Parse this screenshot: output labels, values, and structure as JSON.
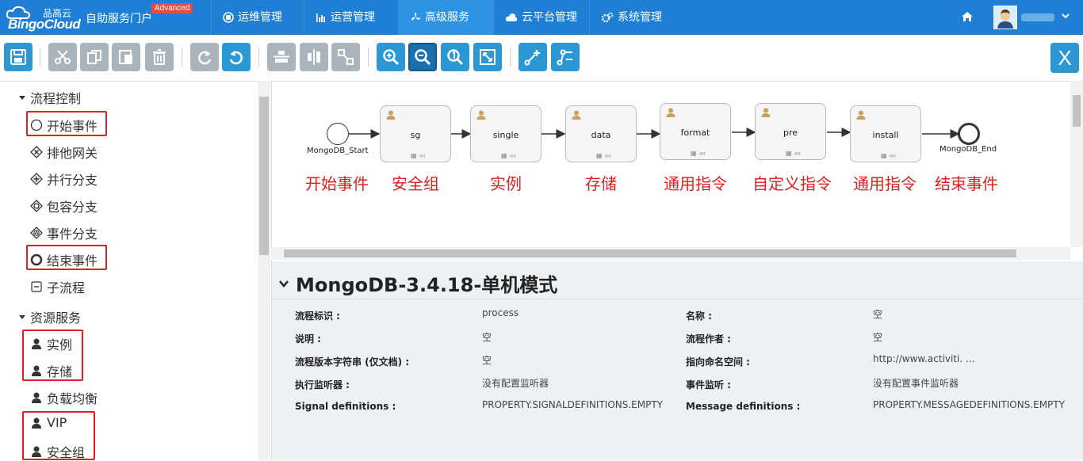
{
  "header": {
    "logo_cn": "品高云",
    "logo_en": "BingoCloud",
    "portal_label": "自助服务门户",
    "badge": "Advanced",
    "nav": [
      {
        "label": "运维管理",
        "icon": "ops-icon"
      },
      {
        "label": "运营管理",
        "icon": "bar-chart-icon"
      },
      {
        "label": "高级服务",
        "icon": "fan-icon"
      },
      {
        "label": "云平台管理",
        "icon": "cloud-icon"
      },
      {
        "label": "系统管理",
        "icon": "gears-icon"
      }
    ],
    "active_nav": "高级服务",
    "colors": {
      "bar": "#1f7fd4",
      "active": "#2f93e4",
      "badge": "#e74c3c"
    }
  },
  "toolbar": {
    "buttons": [
      "save-icon",
      "cut-icon",
      "copy-icon",
      "paste-icon",
      "delete-icon",
      "redo-icon",
      "undo-icon",
      "align-icon",
      "align-center-icon",
      "resize-icon",
      "zoom-in-icon",
      "zoom-out-icon",
      "zoom-actual-icon",
      "zoom-fit-icon",
      "flow-add-icon",
      "flow-branch-icon"
    ],
    "close_label": "X"
  },
  "sidebar": {
    "groups": [
      {
        "label": "流程控制",
        "items": [
          {
            "label": "开始事件",
            "icon": "circle-thin-icon"
          },
          {
            "label": "排他网关",
            "icon": "gateway-x-icon"
          },
          {
            "label": "并行分支",
            "icon": "gateway-plus-icon"
          },
          {
            "label": "包容分支",
            "icon": "gateway-o-icon"
          },
          {
            "label": "事件分支",
            "icon": "gateway-event-icon"
          },
          {
            "label": "结束事件",
            "icon": "circle-thick-icon"
          },
          {
            "label": "子流程",
            "icon": "subprocess-icon"
          }
        ]
      },
      {
        "label": "资源服务",
        "items": [
          {
            "label": "实例",
            "icon": "user-icon"
          },
          {
            "label": "存储",
            "icon": "user-icon"
          },
          {
            "label": "负载均衡",
            "icon": "user-icon"
          },
          {
            "label": "VIP",
            "icon": "user-icon"
          },
          {
            "label": "安全组",
            "icon": "user-icon"
          }
        ]
      }
    ]
  },
  "diagram": {
    "start_label": "MongoDB_Start",
    "end_label": "MongoDB_End",
    "tasks": [
      "sg",
      "single",
      "data",
      "format",
      "pre",
      "install"
    ],
    "annotations": [
      "开始事件",
      "安全组",
      "实例",
      "存储",
      "通用指令",
      "自定义指令",
      "通用指令",
      "结束事件"
    ],
    "annotation_color": "#e02020"
  },
  "properties": {
    "title": "MongoDB-3.4.18-单机模式",
    "rows": [
      {
        "k1": "流程标识 :",
        "v1": "process",
        "k2": "名称 :",
        "v2": "空"
      },
      {
        "k1": "说明 :",
        "v1": "空",
        "k2": "流程作者 :",
        "v2": "空"
      },
      {
        "k1": "流程版本字符串 (仅文档) :",
        "v1": "空",
        "k2": "指向命名空间 :",
        "v2": "http://www.activiti. ..."
      },
      {
        "k1": "执行监听器 :",
        "v1": "没有配置监听器",
        "k2": "事件监听 :",
        "v2": "没有配置事件监听器"
      },
      {
        "k1": "Signal definitions :",
        "v1": "PROPERTY.SIGNALDEFINITIONS.EMPTY",
        "k2": "Message definitions :",
        "v2": "PROPERTY.MESSAGEDEFINITIONS.EMPTY"
      }
    ]
  }
}
